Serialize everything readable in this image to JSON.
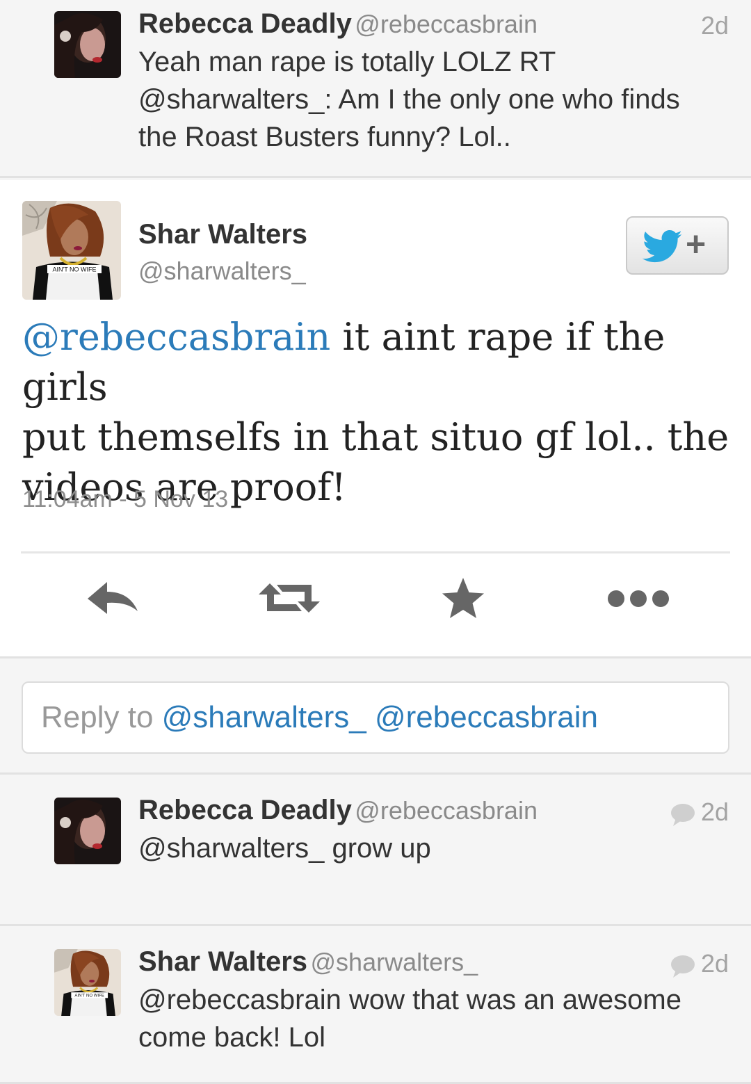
{
  "context_tweet": {
    "name": "Rebecca Deadly",
    "handle": "@rebeccasbrain",
    "age": "2d",
    "text_line1": "Yeah man rape is totally LOLZ RT",
    "text_line2": "@sharwalters_: Am I the only one who finds",
    "text_line3": "the Roast Busters funny? Lol.."
  },
  "focused_tweet": {
    "name": "Shar Walters",
    "handle": "@sharwalters_",
    "avatar_shirt_text": "AIN'T NO WIFE",
    "mention": "@rebeccasbrain",
    "text_line1_rest": " it aint rape if the girls",
    "text_line2": "put themselfs in that situo gf lol.. the",
    "text_line3": "videos are proof!",
    "time": "11:04am",
    "separator": " - ",
    "date": "5 Nov 13",
    "follow_plus": "+"
  },
  "actions": {
    "icons": [
      "reply-icon",
      "retweet-icon",
      "favorite-star-icon",
      "more-icon"
    ]
  },
  "reply_box": {
    "prefix": "Reply to ",
    "mentions": "@sharwalters_ @rebeccasbrain"
  },
  "replies": [
    {
      "name": "Rebecca Deadly",
      "handle": "@rebeccasbrain",
      "age": "2d",
      "text_line1": "@sharwalters_ grow up",
      "text_line2": ""
    },
    {
      "name": "Shar Walters",
      "handle": "@sharwalters_",
      "age": "2d",
      "avatar_shirt_text": "AIN'T NO WIFE",
      "text_line1": "@rebeccasbrain wow that was an awesome",
      "text_line2": "come back! Lol"
    }
  ],
  "colors": {
    "link": "#2b7bb9",
    "twitter_blue": "#2aa9e0",
    "icon_gray": "#666666"
  }
}
